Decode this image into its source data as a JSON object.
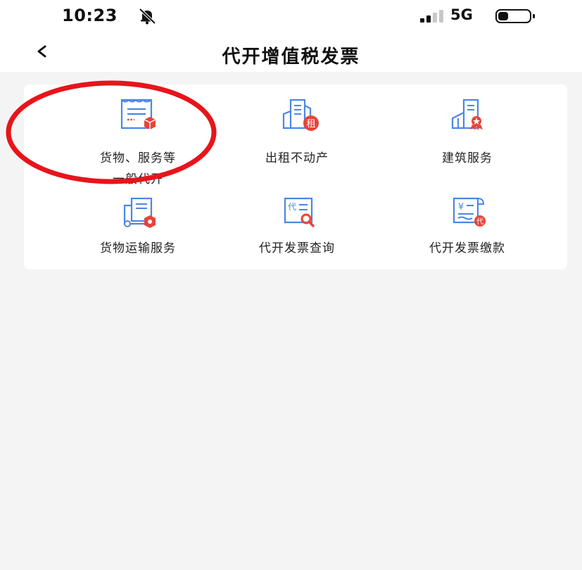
{
  "status_bar": {
    "time": "10:23",
    "network": "5G",
    "bell_icon": "bell-off-icon",
    "signal_icon": "signal-icon",
    "battery_icon": "battery-icon"
  },
  "header": {
    "back_glyph": "<",
    "title": "代开增值税发票"
  },
  "services": [
    {
      "icon": "invoice-goods-icon",
      "label_line1": "货物、服务等",
      "label_line2": "一般代开"
    },
    {
      "icon": "rental-property-icon",
      "label_line1": "出租不动产",
      "badge": "租"
    },
    {
      "icon": "building-service-icon",
      "label_line1": "建筑服务"
    },
    {
      "icon": "freight-transport-icon",
      "label_line1": "货物运输服务"
    },
    {
      "icon": "invoice-query-icon",
      "label_line1": "代开发票查询",
      "badge": "代"
    },
    {
      "icon": "invoice-payment-icon",
      "label_line1": "代开发票缴款",
      "badge": "¥",
      "badge2": "代"
    }
  ],
  "annotation": {
    "color": "#e8141b",
    "target": "services.0"
  },
  "colors": {
    "icon_blue": "#4a86e8",
    "icon_red": "#e8433a",
    "background": "#f4f4f4",
    "card": "#ffffff"
  }
}
